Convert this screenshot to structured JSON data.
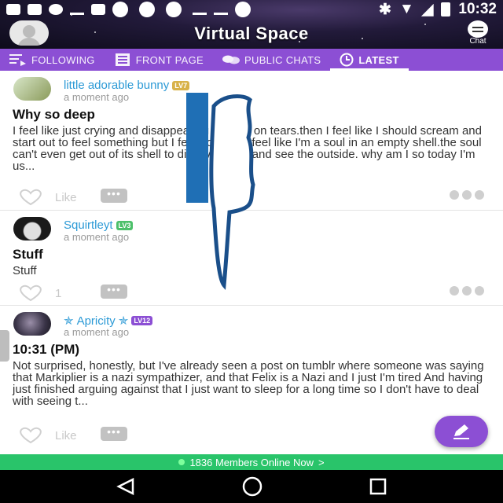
{
  "status_bar": {
    "time": "10:32"
  },
  "header": {
    "title": "Virtual Space",
    "chat_label": "Chat"
  },
  "tabs": [
    {
      "label": "FOLLOWING",
      "icon": "following-icon",
      "active": false
    },
    {
      "label": "FRONT PAGE",
      "icon": "front-page-icon",
      "active": false
    },
    {
      "label": "PUBLIC CHATS",
      "icon": "public-chats-icon",
      "active": false
    },
    {
      "label": "LATEST",
      "icon": "clock-icon",
      "active": true
    }
  ],
  "posts": [
    {
      "author": "little adorable bunny",
      "level": "LV7",
      "time": "a moment ago",
      "title": "Why so deep",
      "body": "I feel like just crying and disappearing into my on tears.then I feel like I should scream and start out to feel something but I feel nothing .I feel like I'm a soul in an empty shell.the soul can't even get out of its shell to discover itself and see the outside. why am I so today I'm us...",
      "like_label": "Like"
    },
    {
      "author": "Squirtleyt",
      "level": "LV3",
      "time": "a moment ago",
      "title": "Stuff",
      "body": "Stuff",
      "like_label": "1"
    },
    {
      "author": "Apricity",
      "level": "LV12",
      "time": "a moment ago",
      "title": "10:31 (PM)",
      "body": "Not surprised, honestly, but I've already seen a post on tumblr where someone was saying that Markiplier is a nazi sympathizer, and that Felix is a Nazi and I just I'm tired And having just finished arguing against that I just want to sleep for a long time so I don't have to deal with seeing t...",
      "like_label": "Like"
    }
  ],
  "online_bar": {
    "text": "1836 Members Online Now",
    "chevron": ">"
  },
  "colors": {
    "accent": "#8c4fd4",
    "link": "#2c9ad6",
    "online": "#29c46a"
  }
}
